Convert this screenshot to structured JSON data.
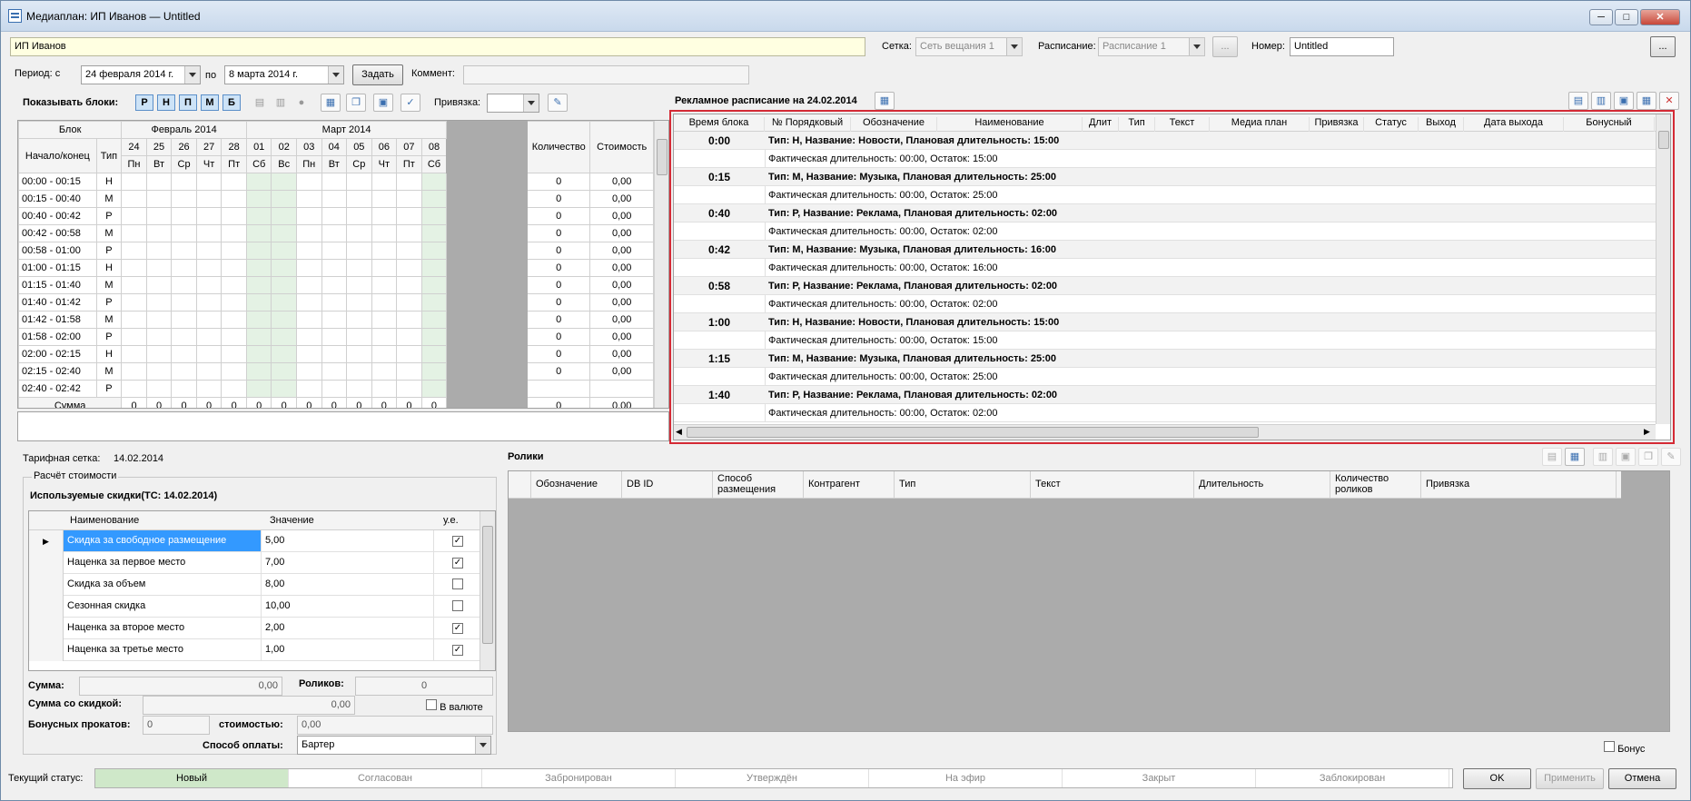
{
  "window": {
    "title": "Медиаплан: ИП Иванов — Untitled",
    "minimize": "─",
    "maximize": "□",
    "close": "✕"
  },
  "top": {
    "client_value": "ИП Иванов",
    "grid_label": "Сетка:",
    "grid_value": "Сеть вещания 1",
    "schedule_label": "Расписание:",
    "schedule_value": "Расписание 1",
    "schedule_browse": "...",
    "number_label": "Номер:",
    "number_value": "Untitled",
    "more_button": "..."
  },
  "period": {
    "from_label": "Период: с",
    "from_value": "24 февраля  2014 г.",
    "to_label": "по",
    "to_value": "8   марта   2014 г.",
    "set_button": "Задать",
    "comment_label": "Коммент:",
    "comment_value": ""
  },
  "blocks": {
    "show_label": "Показывать блоки:",
    "toggles": [
      "Р",
      "Н",
      "П",
      "М",
      "Б"
    ],
    "binding_label": "Привязка:",
    "binding_value": ""
  },
  "left_table": {
    "head_block": "Блок",
    "head_start_end": "Начало/конец",
    "head_type": "Тип",
    "month1": "Февраль 2014",
    "month2": "Март 2014",
    "head_qty": "Количество",
    "head_cost": "Стоимость",
    "days": [
      "24",
      "25",
      "26",
      "27",
      "28",
      "01",
      "02",
      "03",
      "04",
      "05",
      "06",
      "07",
      "08"
    ],
    "weekdays": [
      "Пн",
      "Вт",
      "Ср",
      "Чт",
      "Пт",
      "Сб",
      "Вс",
      "Пн",
      "Вт",
      "Ср",
      "Чт",
      "Пт",
      "Сб"
    ],
    "rows": [
      [
        "00:00 - 00:15",
        "Н",
        "0",
        "0,00"
      ],
      [
        "00:15 - 00:40",
        "М",
        "0",
        "0,00"
      ],
      [
        "00:40 - 00:42",
        "Р",
        "0",
        "0,00"
      ],
      [
        "00:42 - 00:58",
        "М",
        "0",
        "0,00"
      ],
      [
        "00:58 - 01:00",
        "Р",
        "0",
        "0,00"
      ],
      [
        "01:00 - 01:15",
        "Н",
        "0",
        "0,00"
      ],
      [
        "01:15 - 01:40",
        "М",
        "0",
        "0,00"
      ],
      [
        "01:40 - 01:42",
        "Р",
        "0",
        "0,00"
      ],
      [
        "01:42 - 01:58",
        "М",
        "0",
        "0,00"
      ],
      [
        "01:58 - 02:00",
        "Р",
        "0",
        "0,00"
      ],
      [
        "02:00 - 02:15",
        "Н",
        "0",
        "0,00"
      ],
      [
        "02:15 - 02:40",
        "М",
        "0",
        "0,00"
      ]
    ],
    "partial_row": [
      "02:40 - 02:42",
      "Р"
    ],
    "sum_label": "Сумма",
    "sum_days": [
      "0",
      "0",
      "0",
      "0",
      "0",
      "0",
      "0",
      "0",
      "0",
      "0",
      "0",
      "0",
      "0"
    ],
    "sum_qty": "0",
    "sum_cost": "0,00"
  },
  "schedule": {
    "title": "Рекламное расписание на 24.02.2014",
    "columns": [
      "Время блока",
      "№ Порядковый",
      "Обозначение",
      "Наименование",
      "Длит",
      "Тип",
      "Текст",
      "Медиа план",
      "Привязка",
      "Статус",
      "Выход",
      "Дата выхода",
      "Бонусный"
    ],
    "blocks": [
      {
        "time": "0:00",
        "plan": "Тип: Н, Название: Новости, Плановая длительность: 15:00",
        "fact": "Фактическая длительность: 00:00, Остаток: 15:00"
      },
      {
        "time": "0:15",
        "plan": "Тип: М, Название: Музыка, Плановая длительность: 25:00",
        "fact": "Фактическая длительность: 00:00, Остаток: 25:00"
      },
      {
        "time": "0:40",
        "plan": "Тип: Р, Название: Реклама, Плановая длительность: 02:00",
        "fact": "Фактическая длительность: 00:00, Остаток: 02:00"
      },
      {
        "time": "0:42",
        "plan": "Тип: М, Название: Музыка, Плановая длительность: 16:00",
        "fact": "Фактическая длительность: 00:00, Остаток: 16:00"
      },
      {
        "time": "0:58",
        "plan": "Тип: Р, Название: Реклама, Плановая длительность: 02:00",
        "fact": "Фактическая длительность: 00:00, Остаток: 02:00"
      },
      {
        "time": "1:00",
        "plan": "Тип: Н, Название: Новости, Плановая длительность: 15:00",
        "fact": "Фактическая длительность: 00:00, Остаток: 15:00"
      },
      {
        "time": "1:15",
        "plan": "Тип: М, Название: Музыка, Плановая длительность: 25:00",
        "fact": "Фактическая длительность: 00:00, Остаток: 25:00"
      },
      {
        "time": "1:40",
        "plan": "Тип: Р, Название: Реклама, Плановая длительность: 02:00",
        "fact": "Фактическая длительность: 00:00, Остаток: 02:00"
      }
    ]
  },
  "tariff": {
    "label": "Тарифная сетка:",
    "value": "14.02.2014"
  },
  "calc": {
    "group_title": "Расчёт стоимости",
    "discounts_title": "Используемые скидки(ТС: 14.02.2014)",
    "col_name": "Наименование",
    "col_value": "Значение",
    "col_unit": "у.е.",
    "rows": [
      {
        "name": "Скидка за свободное размещение",
        "value": "5,00",
        "checked": true
      },
      {
        "name": "Наценка за первое место",
        "value": "7,00",
        "checked": true
      },
      {
        "name": "Скидка за объем",
        "value": "8,00",
        "checked": false
      },
      {
        "name": "Сезонная скидка",
        "value": "10,00",
        "checked": false
      },
      {
        "name": "Наценка за второе место",
        "value": "2,00",
        "checked": true
      },
      {
        "name": "Наценка за третье место",
        "value": "1,00",
        "checked": true
      }
    ],
    "sum_label": "Сумма:",
    "sum_value": "0,00",
    "rolls_label": "Роликов:",
    "rolls_value": "0",
    "disc_sum_label": "Сумма со скидкой:",
    "disc_sum_value": "0,00",
    "currency_label": "В валюте",
    "bonus_label": "Бонусных прокатов:",
    "bonus_value": "0",
    "cost_label": "стоимостью:",
    "cost_value": "0,00",
    "pay_label": "Способ оплаты:",
    "pay_value": "Бартер"
  },
  "rolls": {
    "title": "Ролики",
    "columns": [
      "Обозначение",
      "DB ID",
      "Способ размещения",
      "Контрагент",
      "Тип",
      "Текст",
      "Длительность",
      "Количество роликов",
      "Привязка"
    ],
    "bonus_label": "Бонус"
  },
  "status": {
    "label": "Текущий статус:",
    "items": [
      "Новый",
      "Согласован",
      "Забронирован",
      "Утверждён",
      "На эфир",
      "Закрыт",
      "Заблокирован"
    ],
    "active_color": "#cfe8c9"
  },
  "footer": {
    "ok": "OK",
    "apply": "Применить",
    "cancel": "Отмена"
  },
  "colors": {
    "client_bg": "#ffffe1",
    "weekend_bg": "#e4f2e4",
    "highlight": "#d42a35",
    "selection": "#3399ff"
  }
}
